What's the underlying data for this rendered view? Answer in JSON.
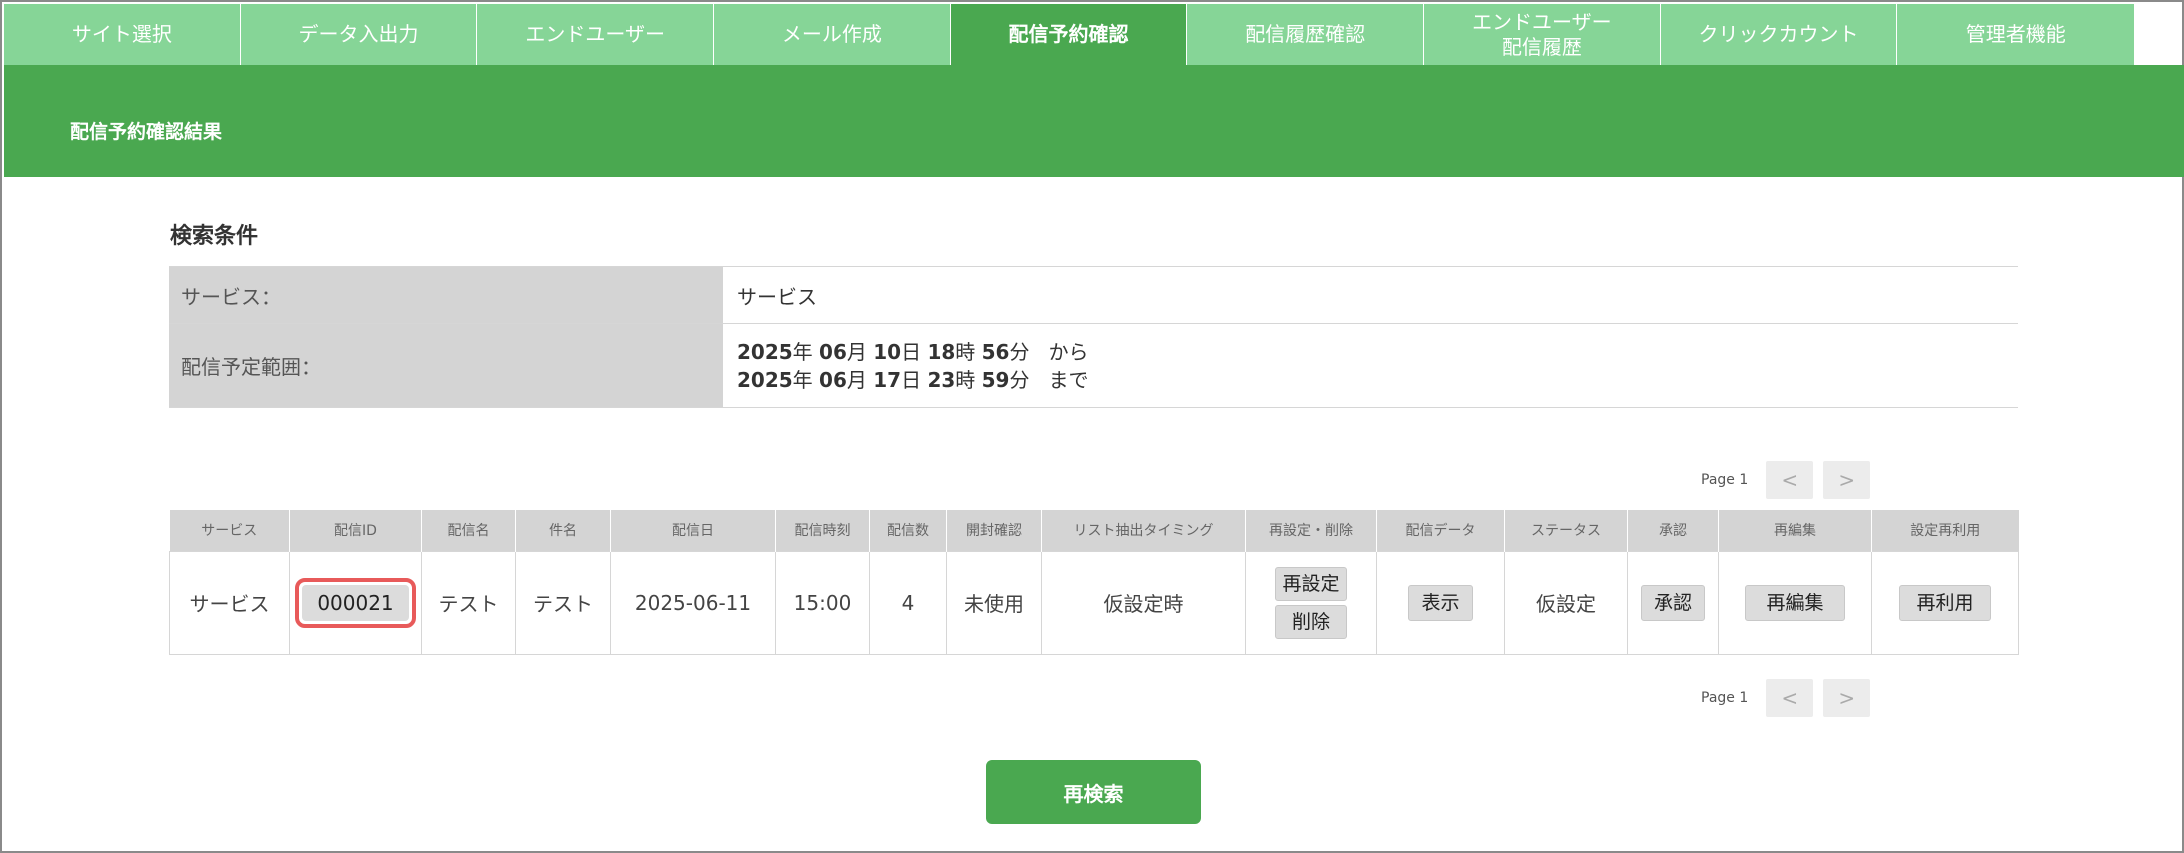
{
  "nav": {
    "tabs": [
      {
        "label": "サイト選択"
      },
      {
        "label": "データ入出力"
      },
      {
        "label": "エンドユーザー"
      },
      {
        "label": "メール作成"
      },
      {
        "label": "配信予約確認"
      },
      {
        "label": "配信履歴確認"
      },
      {
        "label": "エンドユーザー\n配信履歴"
      },
      {
        "label": "クリックカウント"
      },
      {
        "label": "管理者機能"
      }
    ],
    "active_index": 4
  },
  "banner": {
    "title": "配信予約確認結果"
  },
  "conditions": {
    "heading": "検索条件",
    "service_label": "サービス：",
    "service_value": "サービス",
    "range_label": "配信予定範囲：",
    "from": {
      "year": "2025",
      "y": "年",
      "month": "06",
      "m": "月",
      "day": "10",
      "d": "日",
      "hour": "18",
      "h": "時",
      "min": "56",
      "mi": "分",
      "suffix": "から"
    },
    "to": {
      "year": "2025",
      "y": "年",
      "month": "06",
      "m": "月",
      "day": "17",
      "d": "日",
      "hour": "23",
      "h": "時",
      "min": "59",
      "mi": "分",
      "suffix": "まで"
    }
  },
  "pager": {
    "label": "Page 1",
    "prev": "<",
    "next": ">"
  },
  "table": {
    "headers": [
      "サービス",
      "配信ID",
      "配信名",
      "件名",
      "配信日",
      "配信時刻",
      "配信数",
      "開封確認",
      "リスト抽出タイミング",
      "再設定・削除",
      "配信データ",
      "ステータス",
      "承認",
      "再編集",
      "設定再利用"
    ],
    "row": {
      "service": "サービス",
      "id": "000021",
      "name": "テスト",
      "subject": "テスト",
      "date": "2025-06-11",
      "time": "15:00",
      "count": "4",
      "open_check": "未使用",
      "list_timing": "仮設定時",
      "reset": "再設定",
      "delete": "削除",
      "show": "表示",
      "status": "仮設定",
      "approve": "承認",
      "reedit": "再編集",
      "reuse": "再利用"
    }
  },
  "research_button": "再検索",
  "colors": {
    "tab": "#86d597",
    "active": "#4aa850",
    "highlight": "#e85a5a"
  }
}
